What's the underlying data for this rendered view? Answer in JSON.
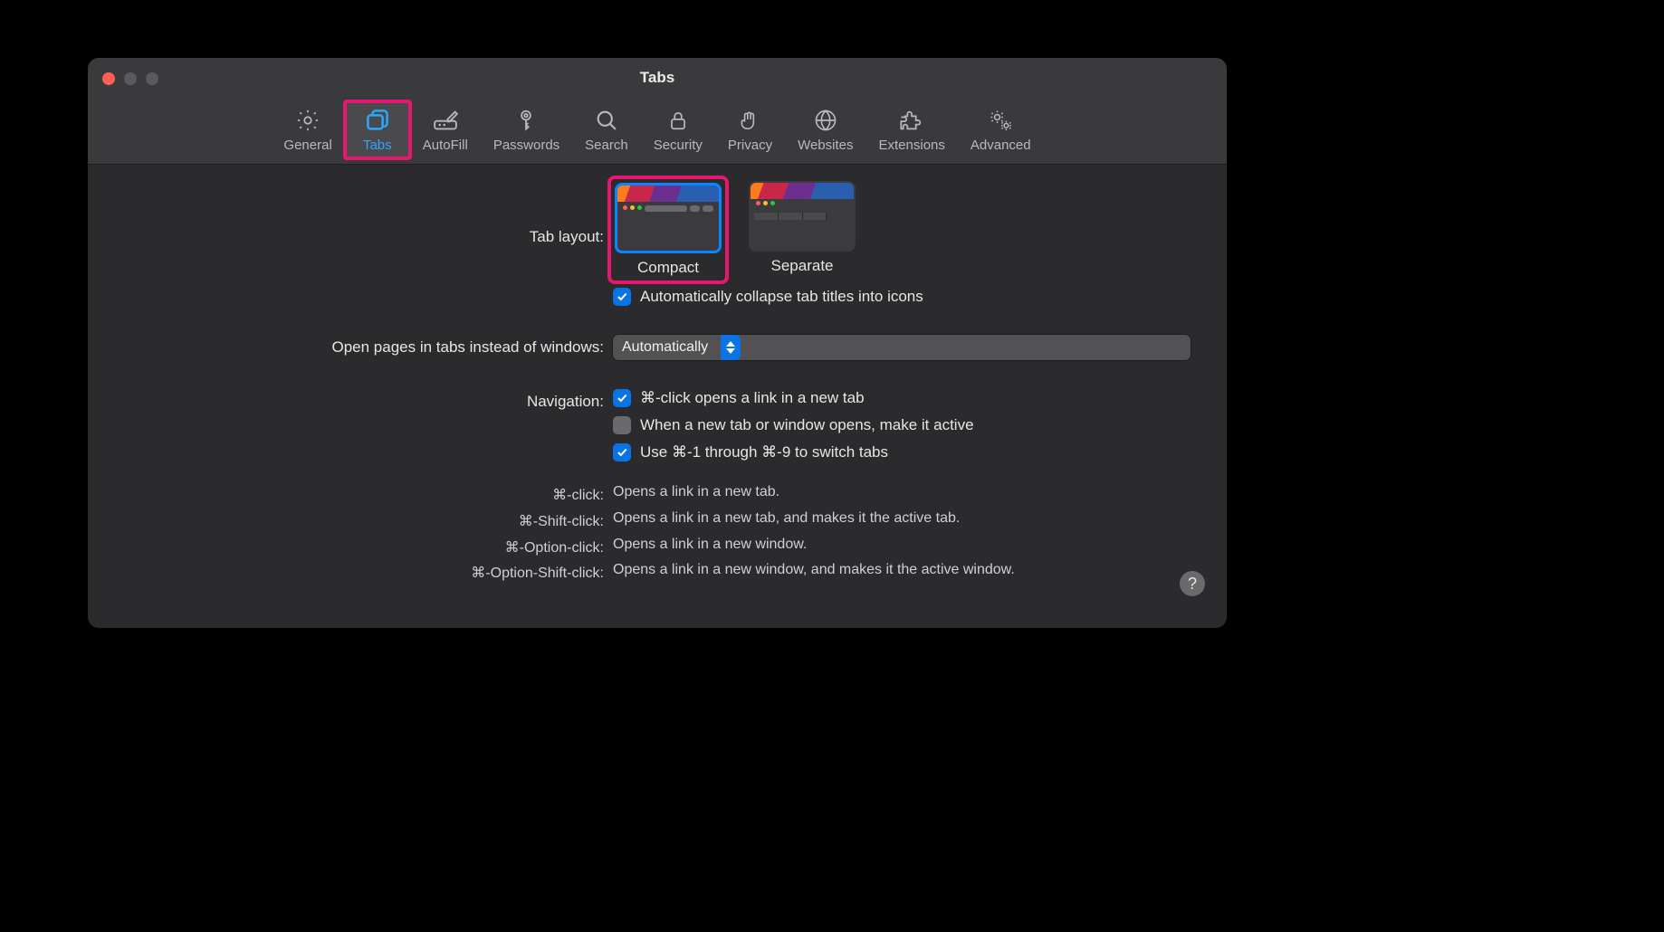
{
  "window": {
    "title": "Tabs"
  },
  "toolbar": {
    "items": [
      {
        "id": "general",
        "label": "General"
      },
      {
        "id": "tabs",
        "label": "Tabs"
      },
      {
        "id": "autofill",
        "label": "AutoFill"
      },
      {
        "id": "passwords",
        "label": "Passwords"
      },
      {
        "id": "search",
        "label": "Search"
      },
      {
        "id": "security",
        "label": "Security"
      },
      {
        "id": "privacy",
        "label": "Privacy"
      },
      {
        "id": "websites",
        "label": "Websites"
      },
      {
        "id": "extensions",
        "label": "Extensions"
      },
      {
        "id": "advanced",
        "label": "Advanced"
      }
    ],
    "active": "tabs"
  },
  "labels": {
    "tab_layout": "Tab layout:",
    "open_pages": "Open pages in tabs instead of windows:",
    "navigation": "Navigation:"
  },
  "tab_layout": {
    "options": [
      {
        "id": "compact",
        "label": "Compact",
        "selected": true
      },
      {
        "id": "separate",
        "label": "Separate",
        "selected": false
      }
    ],
    "collapse_checkbox": {
      "checked": true,
      "label": "Automatically collapse tab titles into icons"
    }
  },
  "open_pages_popup": {
    "value": "Automatically"
  },
  "navigation": {
    "items": [
      {
        "checked": true,
        "label": "⌘-click opens a link in a new tab"
      },
      {
        "checked": false,
        "label": "When a new tab or window opens, make it active"
      },
      {
        "checked": true,
        "label": "Use ⌘-1 through ⌘-9 to switch tabs"
      }
    ]
  },
  "shortcuts": [
    {
      "key": "⌘-click:",
      "desc": "Opens a link in a new tab."
    },
    {
      "key": "⌘-Shift-click:",
      "desc": "Opens a link in a new tab, and makes it the active tab."
    },
    {
      "key": "⌘-Option-click:",
      "desc": "Opens a link in a new window."
    },
    {
      "key": "⌘-Option-Shift-click:",
      "desc": "Opens a link in a new window, and makes it the active window."
    }
  ],
  "help_tooltip": "?"
}
